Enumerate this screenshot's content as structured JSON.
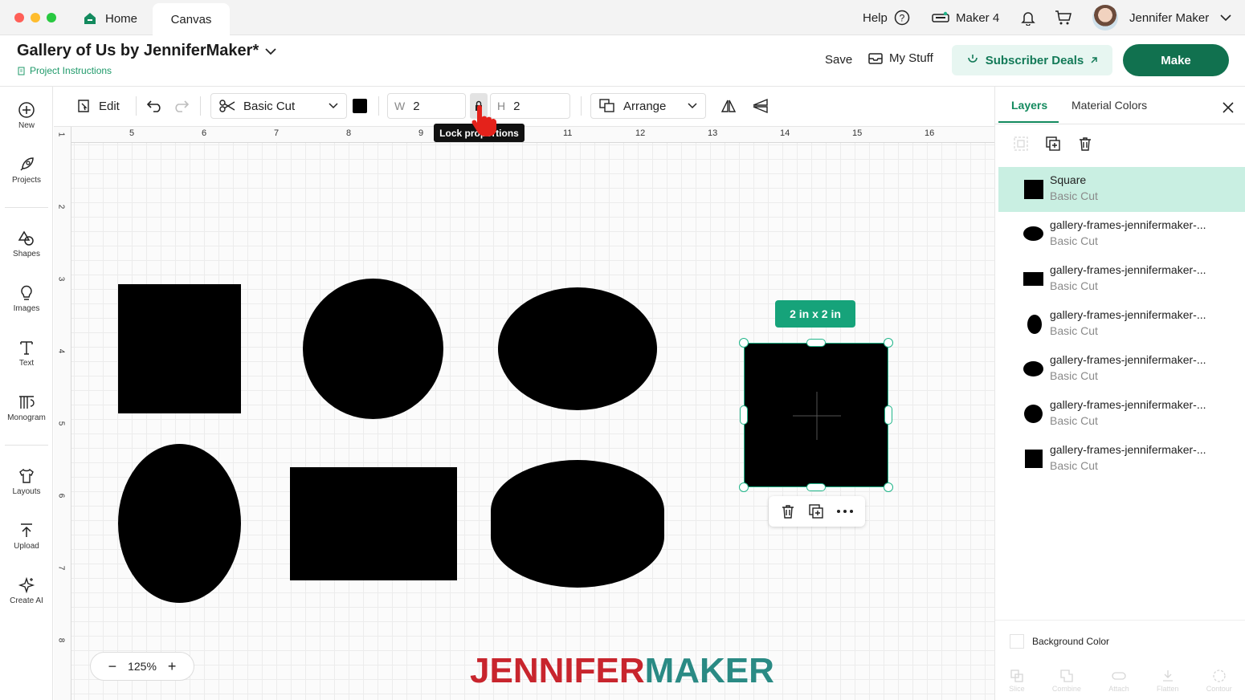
{
  "titlebar": {
    "tabs": [
      "Home",
      "Canvas"
    ],
    "help": "Help",
    "machine": "Maker 4",
    "user": "Jennifer Maker"
  },
  "project": {
    "title": "Gallery of Us by JenniferMaker*",
    "instructions": "Project Instructions",
    "save": "Save",
    "my_stuff": "My Stuff",
    "subscriber_deals": "Subscriber Deals",
    "make": "Make"
  },
  "sidebar": {
    "items": [
      "New",
      "Projects",
      "Shapes",
      "Images",
      "Text",
      "Monogram",
      "Layouts",
      "Upload",
      "Create AI"
    ]
  },
  "toolbar": {
    "edit": "Edit",
    "operation": "Basic Cut",
    "width_label": "W",
    "width_value": "2",
    "height_label": "H",
    "height_value": "2",
    "arrange": "Arrange",
    "tooltip": "Lock proportions"
  },
  "rulers": {
    "top": [
      "5",
      "6",
      "7",
      "8",
      "9",
      "10",
      "11",
      "12",
      "13",
      "14",
      "15",
      "16"
    ],
    "left": [
      "1",
      "2",
      "3",
      "4",
      "5",
      "6",
      "7",
      "8"
    ]
  },
  "canvas": {
    "size_badge": "2 in x 2 in",
    "zoom": "125%",
    "watermark_a": "JENNIFER",
    "watermark_b": "MAKER",
    "colors": {
      "shape": "#000000",
      "selection": "#20b589",
      "accent": "#16a37a",
      "watermark_red": "#c8252d",
      "watermark_teal": "#2a8a84"
    }
  },
  "panel": {
    "tabs": [
      "Layers",
      "Material Colors"
    ],
    "layers": [
      {
        "name": "Square",
        "type": "Basic Cut",
        "shape": "square",
        "selected": true
      },
      {
        "name": "gallery-frames-jennifermaker-...",
        "type": "Basic Cut",
        "shape": "wide-oval"
      },
      {
        "name": "gallery-frames-jennifermaker-...",
        "type": "Basic Cut",
        "shape": "rectangle"
      },
      {
        "name": "gallery-frames-jennifermaker-...",
        "type": "Basic Cut",
        "shape": "tall-oval"
      },
      {
        "name": "gallery-frames-jennifermaker-...",
        "type": "Basic Cut",
        "shape": "wide-oval"
      },
      {
        "name": "gallery-frames-jennifermaker-...",
        "type": "Basic Cut",
        "shape": "circle"
      },
      {
        "name": "gallery-frames-jennifermaker-...",
        "type": "Basic Cut",
        "shape": "square"
      }
    ],
    "background_color": "Background Color",
    "bottom_tools": [
      "Slice",
      "Combine",
      "Attach",
      "Flatten",
      "Contour"
    ]
  }
}
